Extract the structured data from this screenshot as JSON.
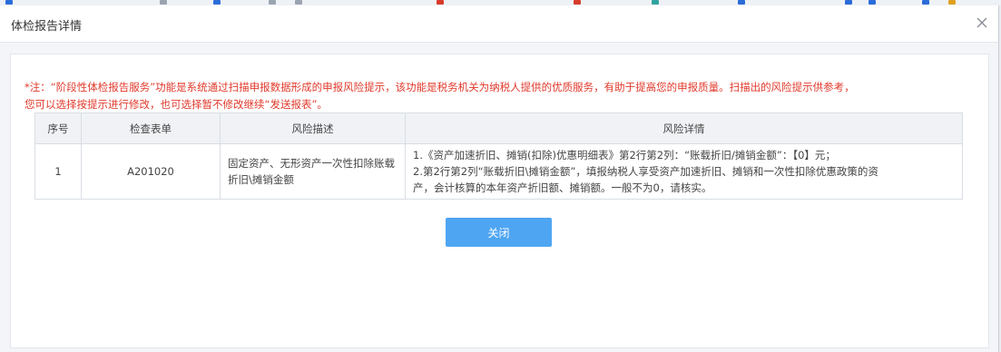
{
  "dialog": {
    "title": "体检报告详情"
  },
  "notice": {
    "line1": "*注：“阶段性体检报告服务”功能是系统通过扫描申报数据形成的申报风险提示，该功能是税务机关为纳税人提供的优质服务，有助于提高您的申报质量。扫描出的风险提示供参考，",
    "line2": "您可以选择按提示进行修改，也可选择暂不修改继续“发送报表”。"
  },
  "table": {
    "headers": [
      "序号",
      "检查表单",
      "风险描述",
      "风险详情"
    ],
    "rows": [
      {
        "index": "1",
        "form": "A201020",
        "description": "固定资产、无形资产一次性扣除账载折旧\\摊销金额",
        "detail_lines": [
          "1.《资产加速折旧、摊销(扣除)优惠明细表》第2行第2列：“账载折旧/摊销金额”：【0】元；",
          "2.第2行第2列“账载折旧\\摊销金额”，填报纳税人享受资产加速折旧、摊销和一次性扣除优惠政策的资",
          "产，会计核算的本年资产折旧额、摊销额。一般不为0，请核实。"
        ]
      }
    ]
  },
  "buttons": {
    "close_label": "关闭"
  },
  "colors": {
    "notice_text": "#e0392b",
    "primary_button": "#4ea5f2",
    "header_bg": "#f0f2f5"
  },
  "icons": {
    "dialog_close": "close-icon"
  }
}
